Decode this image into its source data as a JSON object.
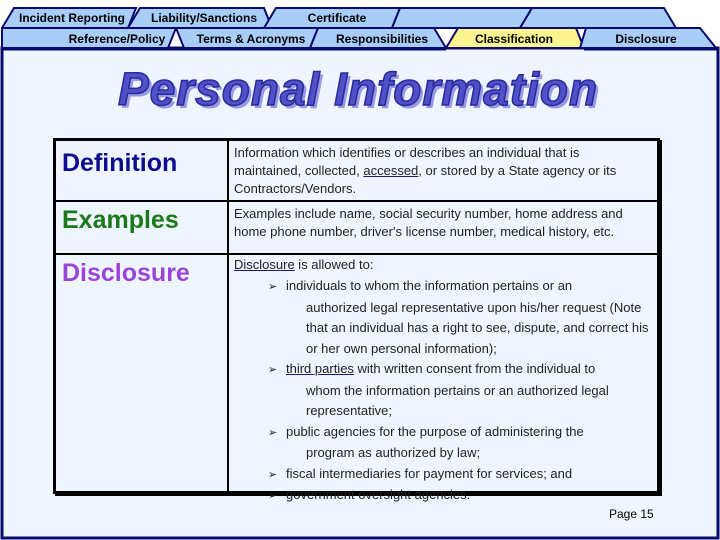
{
  "tabs": {
    "row1": [
      {
        "label": "Incident Reporting"
      },
      {
        "label": "Liability/Sanctions"
      },
      {
        "label": "Certificate"
      },
      {
        "label": ""
      },
      {
        "label": ""
      }
    ],
    "row2": [
      {
        "label": "Reference/Policy"
      },
      {
        "label": "Terms & Acronyms"
      },
      {
        "label": "Responsibilities"
      },
      {
        "label": "Classification",
        "active": true
      },
      {
        "label": "Disclosure"
      }
    ]
  },
  "colors": {
    "tab_fill": "#a8cef8",
    "tab_active_fill": "#fbf590",
    "tab_border": "#0a0a6e",
    "page_bg": "#eef5fe",
    "title_color": "#5050c8",
    "definition_color": "#0c0c8c",
    "examples_color": "#1a7a1a",
    "disclosure_color": "#9a44d8"
  },
  "title": "Personal Information",
  "rows": {
    "definition": {
      "term": "Definition",
      "text_before": "Information which identifies or describes an individual that is maintained, collected, ",
      "text_link": "accessed",
      "text_after": ", or stored by a State agency or its Contractors/Vendors."
    },
    "examples": {
      "term": "Examples",
      "text": "Examples include name, social security number, home address and home phone number, driver's license number, medical history, etc."
    },
    "disclosure": {
      "term": "Disclosure",
      "intro_link": "Disclosure",
      "intro_rest": " is allowed to:",
      "bullets": [
        {
          "first": "individuals to whom the information pertains or an",
          "cont": "authorized legal representative upon his/her request (Note that an individual has a right to see, dispute, and correct his or her own personal information);"
        },
        {
          "link": "third parties",
          "first": " with written consent from the individual to",
          "cont": "whom the information pertains or an authorized legal representative;"
        },
        {
          "first": "public agencies for the purpose of administering the",
          "cont": "program as authorized by law;"
        },
        {
          "first": "fiscal intermediaries for payment for services; and"
        },
        {
          "first": "government oversight agencies."
        }
      ]
    }
  },
  "footer": {
    "page": "Page 15"
  }
}
